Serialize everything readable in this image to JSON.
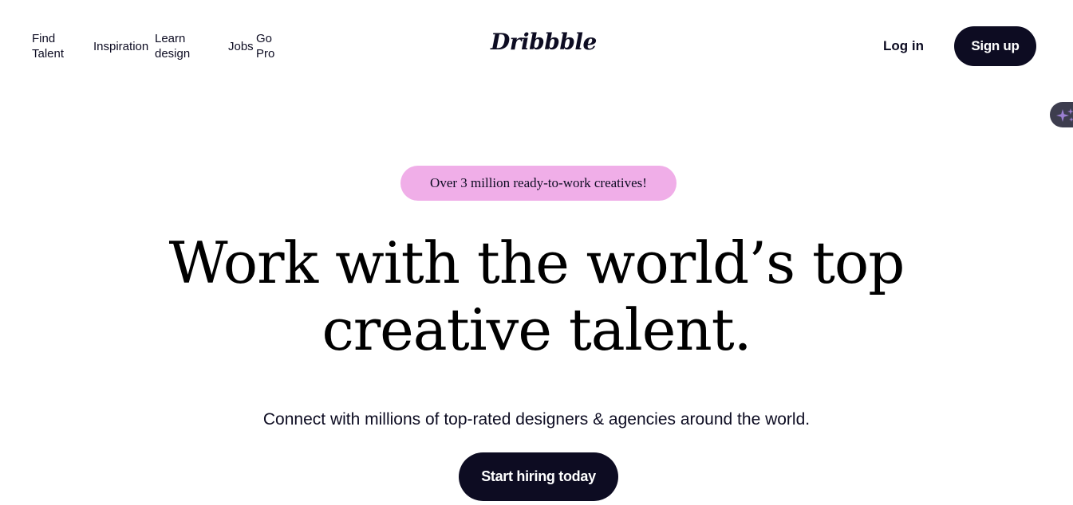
{
  "nav": {
    "links": [
      {
        "label": "Find Talent"
      },
      {
        "label": "Inspiration"
      },
      {
        "label": "Learn design"
      },
      {
        "label": "Jobs"
      },
      {
        "label": "Go Pro"
      }
    ],
    "logo": "Dribbble",
    "login_label": "Log in",
    "signup_label": "Sign up",
    "ai_assistant_icon": "sparkle-icon"
  },
  "hero": {
    "badge": "Over 3 million ready-to-work creatives!",
    "headline_line1": "Work with the world’s top",
    "headline_line2": "creative talent.",
    "subheadline": "Connect with millions of top-rated designers & agencies around the world.",
    "cta_label": "Start hiring today"
  },
  "colors": {
    "brand_dark": "#0d0c22",
    "badge_pink": "#f0aee8",
    "background": "#ffffff",
    "ai_tab": "#3d3d4e",
    "sparkle": "#9a7fd0"
  }
}
